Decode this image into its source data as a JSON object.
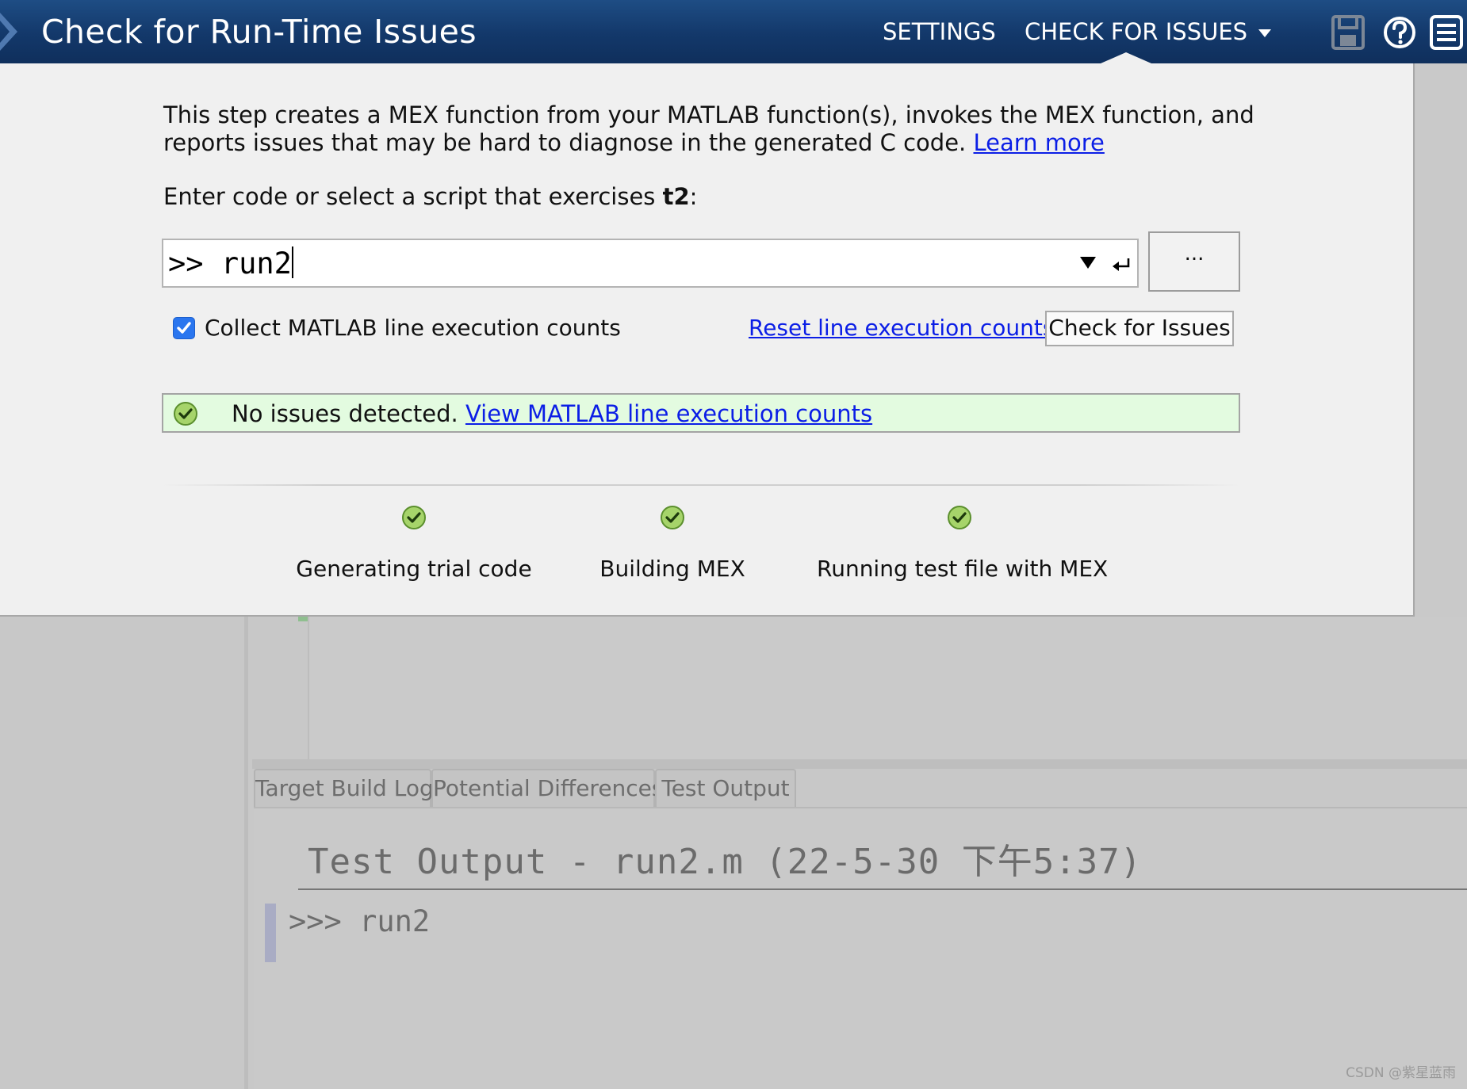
{
  "header": {
    "title": "Check for Run-Time Issues",
    "nav": {
      "settings": "SETTINGS",
      "check_for_issues": "CHECK FOR ISSUES"
    },
    "icons": [
      "save-icon",
      "help-icon",
      "menu-icon"
    ]
  },
  "panel": {
    "description_text": "This step creates a MEX function from your MATLAB function(s), invokes the MEX function, and reports issues that may be hard to diagnose in the generated C code.",
    "learn_more": "Learn more",
    "prompt_prefix": "Enter code or select a script that exercises ",
    "function_name": "t2",
    "prompt_suffix": ":",
    "code_input": {
      "prefix": ">> ",
      "value": "run2"
    },
    "browse_label": "...",
    "collect_counts": {
      "label": "Collect MATLAB line execution counts",
      "checked": true
    },
    "reset_link": "Reset line execution counts",
    "check_button": "Check for Issues",
    "status": {
      "text": "No issues detected.",
      "link": "View MATLAB line execution counts"
    },
    "steps": [
      {
        "label": "Generating trial code",
        "status": "done"
      },
      {
        "label": "Building MEX",
        "status": "done"
      },
      {
        "label": "Running test file with MEX",
        "status": "done"
      }
    ]
  },
  "bottom": {
    "tabs": [
      {
        "label": "Target Build Log"
      },
      {
        "label": "Potential Differences"
      },
      {
        "label": "Test Output"
      }
    ],
    "output_title": "Test Output - run2.m   (22-5-30 下午5:37)",
    "output_line": ">>> run2"
  },
  "watermark": "CSDN @紫星蓝雨",
  "colors": {
    "header": "#13386a",
    "panel": "#f0f0f0",
    "success_bg": "#e3fbe0",
    "link": "#0b1ee6",
    "checkbox": "#2a76ef"
  }
}
